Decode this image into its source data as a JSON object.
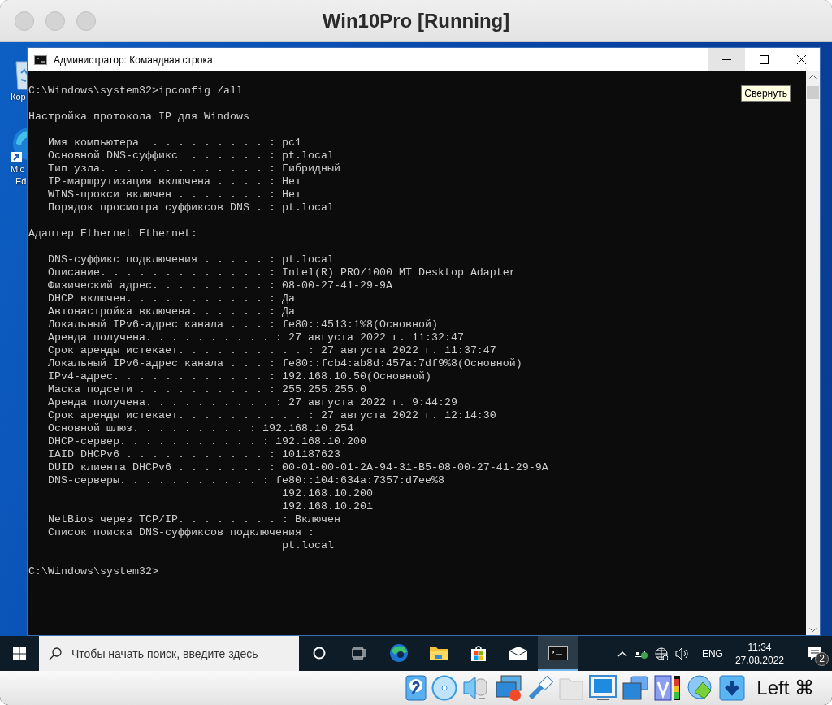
{
  "host_window": {
    "title": "Win10Pro [Running]"
  },
  "desktop": {
    "icons": [
      {
        "kind": "recycle-bin",
        "label_lines": [
          "Кор"
        ]
      },
      {
        "kind": "browser",
        "label_lines": [
          "Mic",
          "Ed"
        ]
      }
    ]
  },
  "console": {
    "title": "Администратор: Командная строка",
    "window_buttons": [
      {
        "kind": "minimize",
        "hovered": true
      },
      {
        "kind": "maximize",
        "hovered": false
      },
      {
        "kind": "close",
        "hovered": false
      }
    ],
    "tooltip": "Свернуть",
    "blocks": [
      [
        "C:\\Windows\\system32>ipconfig /all"
      ],
      [
        "Настройка протокола IP для Windows"
      ],
      [
        "   Имя компьютера  . . . . . . . . . : pc1",
        "   Основной DNS-суффикс  . . . . . . : pt.local",
        "   Тип узла. . . . . . . . . . . . . : Гибридный",
        "   IP-маршрутизация включена . . . . : Нет",
        "   WINS-прокси включен . . . . . . . : Нет",
        "   Порядок просмотра суффиксов DNS . : pt.local"
      ],
      [
        "Адаптер Ethernet Ethernet:"
      ],
      [
        "   DNS-суффикс подключения . . . . . : pt.local",
        "   Описание. . . . . . . . . . . . . : Intel(R) PRO/1000 MT Desktop Adapter",
        "   Физический адрес. . . . . . . . . : 08-00-27-41-29-9A",
        "   DHCP включен. . . . . . . . . . . : Да",
        "   Автонастройка включена. . . . . . : Да",
        "   Локальный IPv6-адрес канала . . . : fe80::4513:1%8(Основной)",
        "   Аренда получена. . . . . . . . . . : 27 августа 2022 г. 11:32:47",
        "   Срок аренды истекает. . . . . . . . . . : 27 августа 2022 г. 11:37:47",
        "   Локальный IPv6-адрес канала . . . : fe80::fcb4:ab8d:457a:7df9%8(Основной)",
        "   IPv4-адрес. . . . . . . . . . . . : 192.168.10.50(Основной)",
        "   Маска подсети . . . . . . . . . . : 255.255.255.0",
        "   Аренда получена. . . . . . . . . . : 27 августа 2022 г. 9:44:29",
        "   Срок аренды истекает. . . . . . . . . . : 27 августа 2022 г. 12:14:30",
        "   Основной шлюз. . . . . . . . . : 192.168.10.254",
        "   DHCP-сервер. . . . . . . . . . . : 192.168.10.200",
        "   IAID DHCPv6 . . . . . . . . . . . : 101187623",
        "   DUID клиента DHCPv6 . . . . . . . : 00-01-00-01-2A-94-31-B5-08-00-27-41-29-9A",
        "   DNS-серверы. . . . . . . . . . . : fe80::104:634a:7357:d7ee%8",
        "                                       192.168.10.200",
        "                                       192.168.10.201",
        "   NetBios через TCP/IP. . . . . . . . : Включен",
        "   Список поиска DNS-суффиксов подключения :",
        "                                       pt.local"
      ],
      [
        "C:\\Windows\\system32>"
      ]
    ]
  },
  "taskbar": {
    "search_placeholder": "Чтобы начать поиск, введите здесь",
    "apps": [
      {
        "kind": "cortana",
        "selected": false
      },
      {
        "kind": "task-view",
        "selected": false
      },
      {
        "kind": "edge",
        "selected": false
      },
      {
        "kind": "explorer",
        "selected": false
      },
      {
        "kind": "store",
        "selected": false
      },
      {
        "kind": "mail",
        "selected": false
      },
      {
        "kind": "cmd",
        "selected": true
      }
    ],
    "language": "ENG",
    "time": "11:34",
    "date": "27.08.2022",
    "notifications": "2"
  },
  "vm_statusbar": {
    "host_key": "Left ⌘"
  }
}
